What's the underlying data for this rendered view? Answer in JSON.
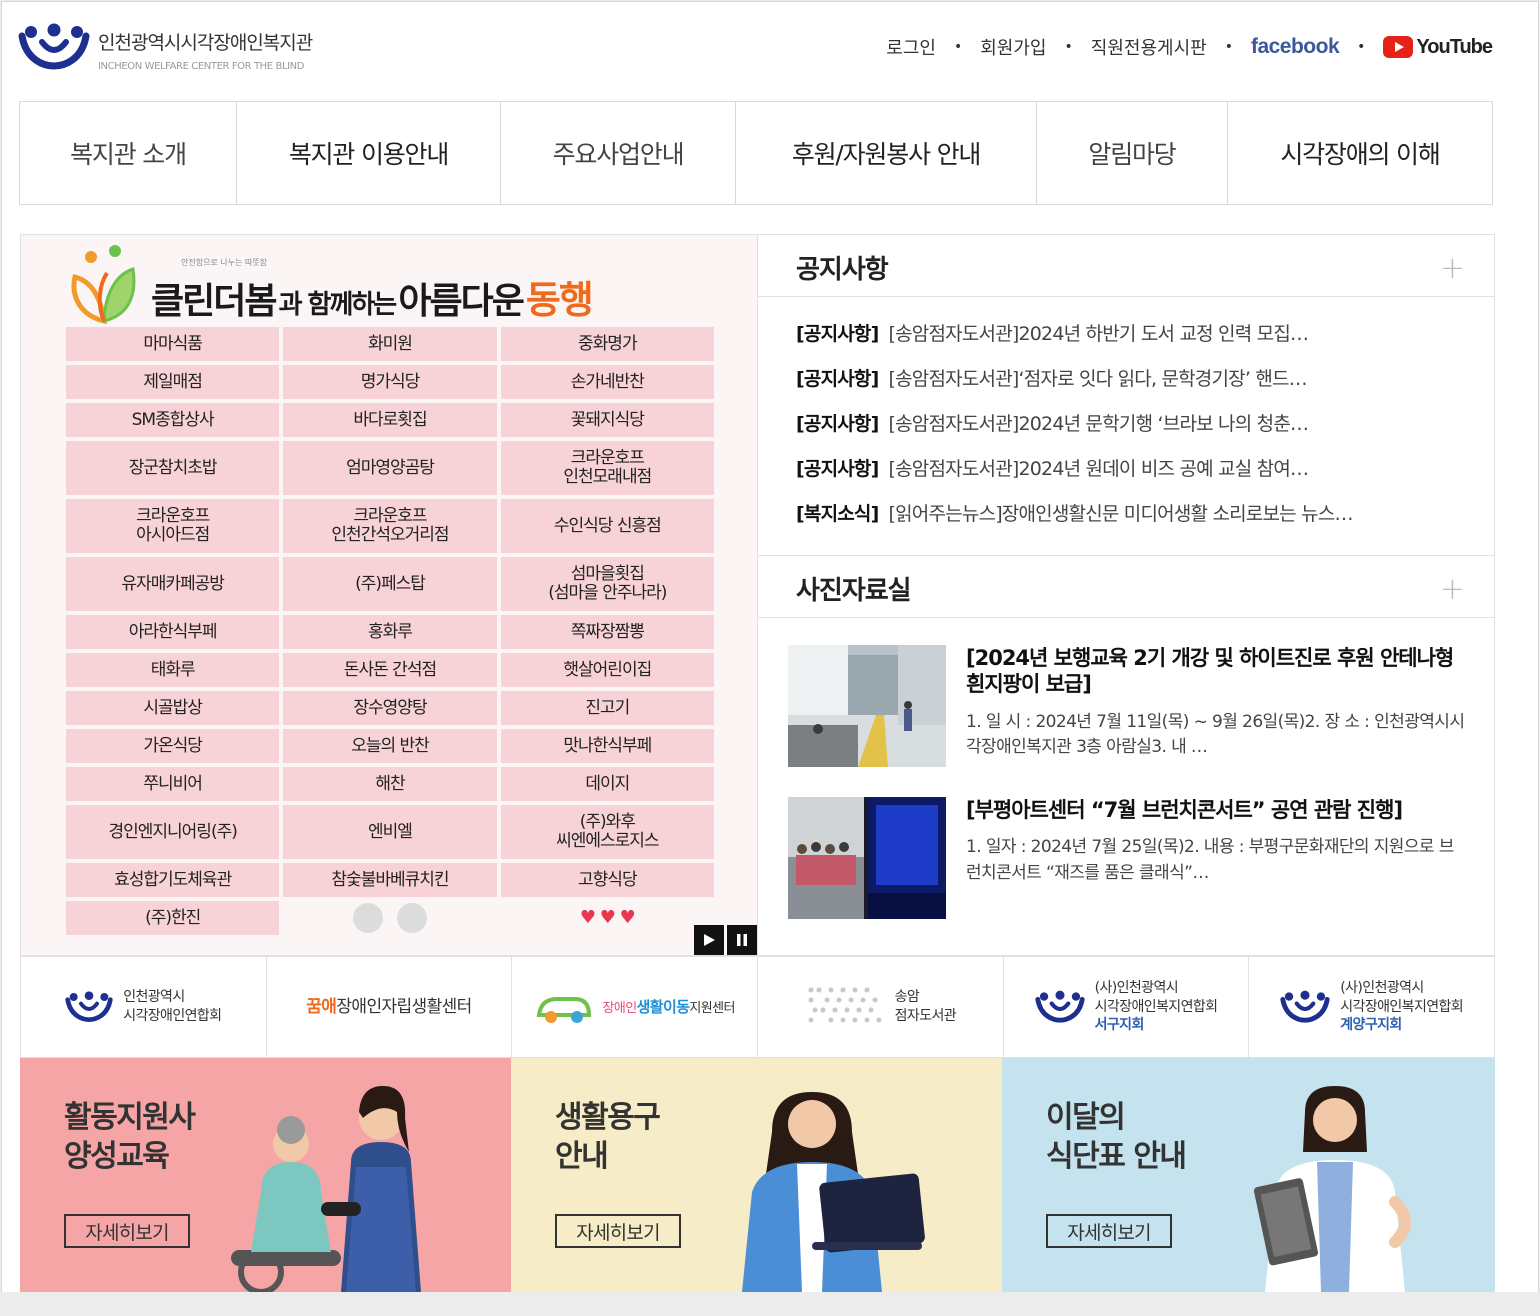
{
  "header": {
    "logo_title": "인천광역시시각장애인복지관",
    "logo_subtitle": "INCHEON WELFARE CENTER FOR THE BLIND",
    "util_links": [
      "로그인",
      "회원가입",
      "직원전용게시판"
    ],
    "facebook_label": "facebook",
    "youtube_label": "YouTube"
  },
  "gnb": {
    "items": [
      "복지관 소개",
      "복지관 이용안내",
      "주요사업안내",
      "후원/자원봉사 안내",
      "알림마당",
      "시각장애의 이해"
    ]
  },
  "banner": {
    "small_text": "안전함으로 나누는 따뜻함",
    "title_part1": "클린더봄",
    "title_part2": "과 함께하는",
    "title_part3": "아름다운",
    "title_part4": "동행",
    "stores": [
      [
        "마마식품",
        "화미원",
        "중화명가"
      ],
      [
        "제일매점",
        "명가식당",
        "손가네반찬"
      ],
      [
        "SM종합상사",
        "바다로횟집",
        "꽃돼지식당"
      ],
      [
        "장군참치초밥",
        "엄마영양곰탕",
        "크라운호프\n인천모래내점"
      ],
      [
        "크라운호프\n아시아드점",
        "크라운호프\n인천간석오거리점",
        "수인식당 신흥점"
      ],
      [
        "유자매카페공방",
        "(주)페스탑",
        "섬마을횟집\n(섬마을 안주나라)"
      ],
      [
        "아라한식부페",
        "홍화루",
        "쪽짜장짬뽕"
      ],
      [
        "태화루",
        "돈사돈 간석점",
        "햇살어린이집"
      ],
      [
        "시골밥상",
        "장수영양탕",
        "진고기"
      ],
      [
        "가온식당",
        "오늘의 반찬",
        "맛나한식부페"
      ],
      [
        "쭈니비어",
        "해찬",
        "데이지"
      ],
      [
        "경인엔지니어링(주)",
        "엔비엘",
        "(주)와후\n씨엔에스로지스"
      ],
      [
        "효성합기도체육관",
        "참숯불바베큐치킨",
        "고향식당"
      ],
      [
        "(주)한진",
        "",
        ""
      ]
    ]
  },
  "notice": {
    "title": "공지사항",
    "items": [
      {
        "category": "[공지사항]",
        "title": "[송암점자도서관]2024년 하반기 도서 교정 인력 모집…"
      },
      {
        "category": "[공지사항]",
        "title": "[송암점자도서관]‘점자로 잇다 읽다, 문학경기장’ 핸드…"
      },
      {
        "category": "[공지사항]",
        "title": "[송암점자도서관]2024년 문학기행 ‘브라보 나의 청춘…"
      },
      {
        "category": "[공지사항]",
        "title": "[송암점자도서관]2024년 원데이 비즈 공예 교실 참여…"
      },
      {
        "category": "[복지소식]",
        "title": "[읽어주는뉴스]장애인생활신문 미디어생활 소리로보는 뉴스…"
      }
    ]
  },
  "photo": {
    "title": "사진자료실",
    "items": [
      {
        "title": "[2024년 보행교육 2기 개강 및 하이트진로 후원 안테나형 흰지팡이 보급]",
        "desc": "1. 일 시 : 2024년 7월 11일(목) ~ 9월 26일(목)2. 장 소 : 인천광역시시각장애인복지관 3층 아람실3. 내 …"
      },
      {
        "title": "[부평아트센터 “7월 브런치콘서트” 공연 관람 진행]",
        "desc": " 1. 일자 : 2024년 7월 25일(목)2. 내용 : 부평구문화재단의 지원으로 브런치콘서트 “재즈를 품은 클래식”…"
      }
    ]
  },
  "partners": [
    {
      "line1": "인천광역시",
      "line2": "시각장애인연합회",
      "line3": ""
    },
    {
      "line1": "꿈애",
      "line2": "장애인자립생활센터",
      "line3": ""
    },
    {
      "line1": "장애인",
      "line2": "생활이동",
      "line3": "지원센터"
    },
    {
      "line1": "송암",
      "line2": "점자도서관",
      "line3": ""
    },
    {
      "line1": "(사)인천광역시",
      "line2": "시각장애인복지연합회",
      "line3": "서구지회"
    },
    {
      "line1": "(사)인천광역시",
      "line2": "시각장애인복지연합회",
      "line3": "계양구지회"
    }
  ],
  "bottom_banners": [
    {
      "line1": "활동지원사",
      "line2": "양성교육",
      "button": "자세히보기",
      "bg": "#f6a5a6"
    },
    {
      "line1": "생활용구",
      "line2": "안내",
      "button": "자세히보기",
      "bg": "#f6ecc7"
    },
    {
      "line1": "이달의",
      "line2": "식단표 안내",
      "button": "자세히보기",
      "bg": "#c5e3ef"
    }
  ],
  "colors": {
    "accent_blue": "#1d2f8f",
    "store_cell": "#f7d2d6",
    "banner_orange": "#ef6a1c",
    "facebook": "#3b5998",
    "youtube": "#e62117"
  }
}
